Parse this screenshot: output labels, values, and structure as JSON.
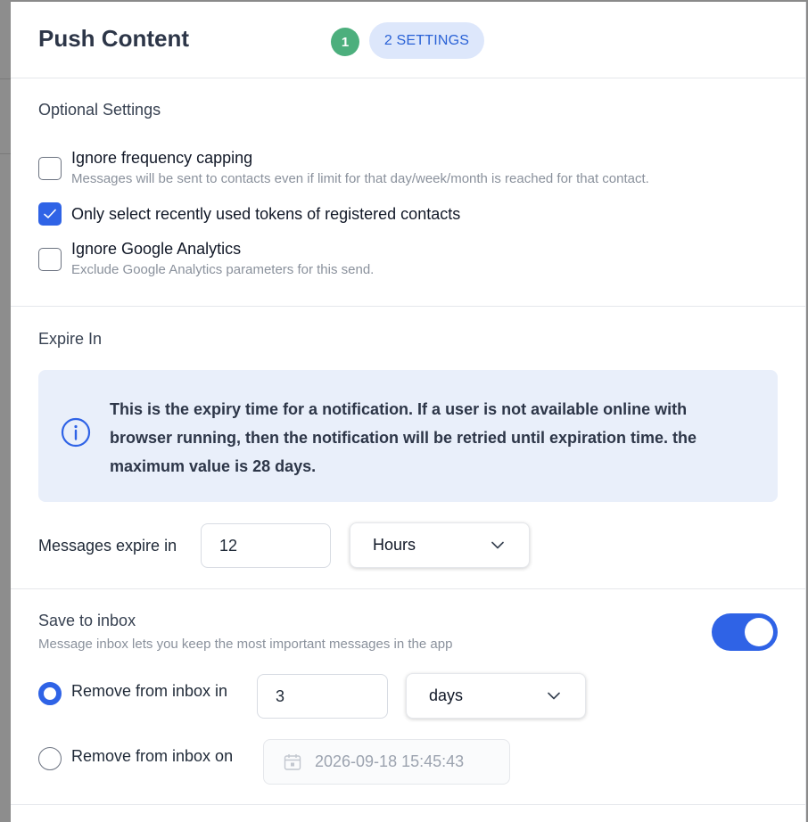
{
  "header": {
    "title": "Push Content",
    "step1_number": "1",
    "step2_label": "2 SETTINGS"
  },
  "optional_settings": {
    "title": "Optional Settings",
    "items": [
      {
        "label": "Ignore frequency capping",
        "description": "Messages will be sent to contacts even if limit for that day/week/month is reached for that contact.",
        "checked": false
      },
      {
        "label": "Only select recently used tokens of registered contacts",
        "description": "",
        "checked": true
      },
      {
        "label": "Ignore Google Analytics",
        "description": "Exclude Google Analytics parameters for this send.",
        "checked": false
      }
    ]
  },
  "expire_in": {
    "title": "Expire In",
    "info_text": "This is the expiry time for a notification. If a user is not available online with browser running, then the notification will be retried until expiration time. the maximum value is 28 days.",
    "messages_expire_label": "Messages expire in",
    "value": "12",
    "unit_selected": "Hours"
  },
  "save_to_inbox": {
    "title": "Save to inbox",
    "description": "Message inbox lets you keep the most important messages in the app",
    "enabled": true,
    "remove_in": {
      "label": "Remove from inbox in",
      "value": "3",
      "unit_selected": "days",
      "selected": true
    },
    "remove_on": {
      "label": "Remove from inbox on",
      "date_value": "2026-09-18 15:45:43",
      "selected": false
    }
  },
  "colors": {
    "primary": "#2f63e6",
    "step_done": "#4caf7d",
    "step_active_bg": "#dde7fb",
    "info_bg": "#e9effa"
  },
  "icons": [
    "info-circle-icon",
    "chevron-down-icon",
    "check-icon",
    "calendar-icon"
  ]
}
